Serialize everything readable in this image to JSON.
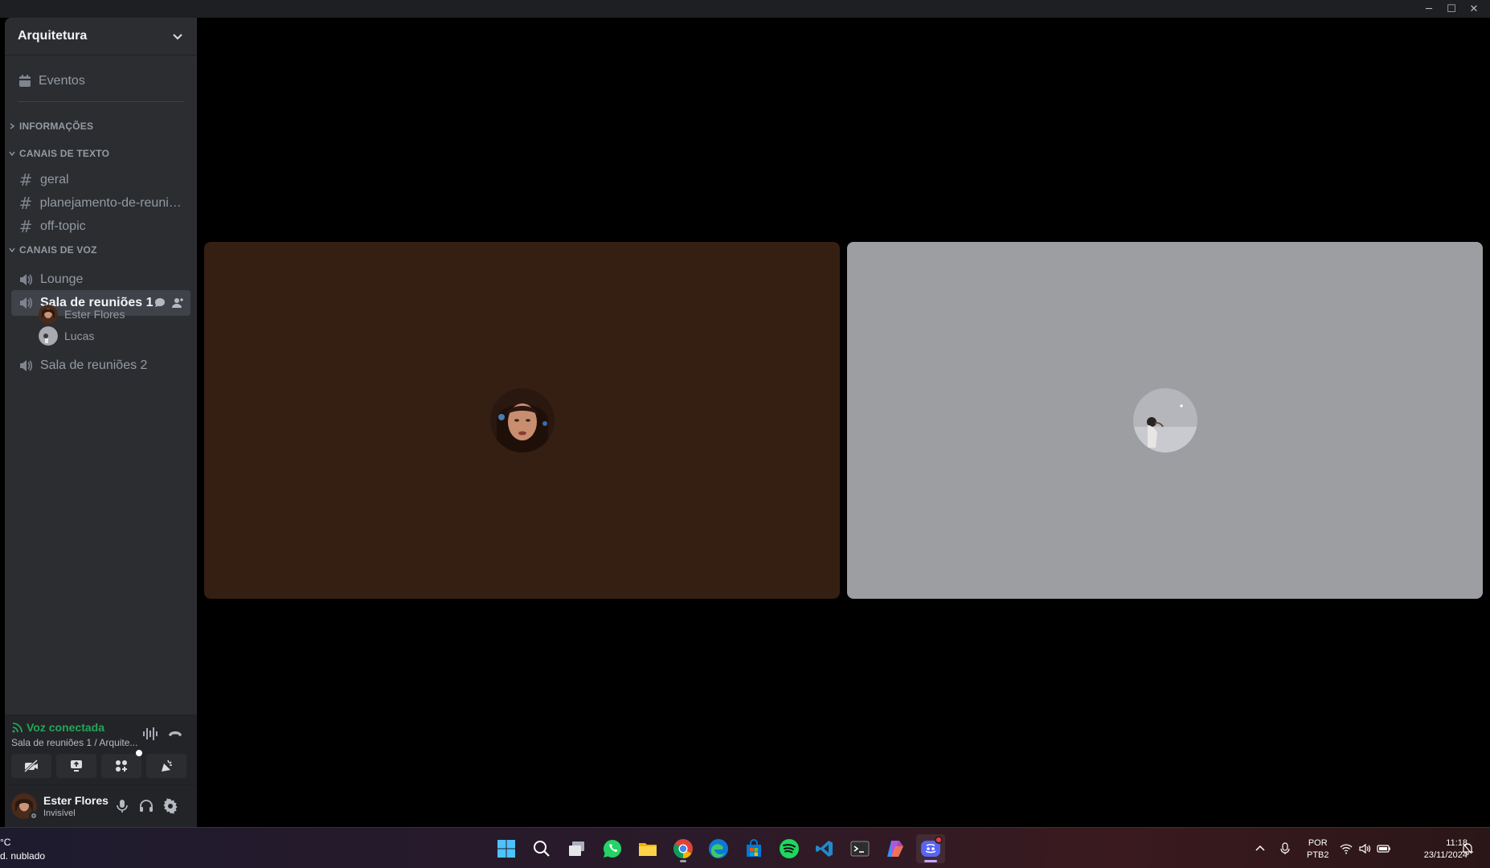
{
  "window": {
    "minimize": "─",
    "maximize": "☐",
    "close": "✕"
  },
  "server": {
    "name": "Arquitetura",
    "events_label": "Eventos"
  },
  "categories": {
    "info": "INFORMAÇÕES",
    "text": "CANAIS DE TEXTO",
    "voice": "CANAIS DE VOZ"
  },
  "text_channels": [
    {
      "name": "geral"
    },
    {
      "name": "planejamento-de-reuniõ..."
    },
    {
      "name": "off-topic"
    }
  ],
  "voice_channels": [
    {
      "name": "Lounge"
    },
    {
      "name": "Sala de reuniões 1"
    },
    {
      "name": "Sala de reuniões 2"
    }
  ],
  "voice_members": [
    {
      "name": "Ester Flores"
    },
    {
      "name": "Lucas"
    }
  ],
  "voice_panel": {
    "status": "Voz conectada",
    "location": "Sala de reuniões 1 / Arquite..."
  },
  "user": {
    "name": "Ester Flores",
    "status": "Invisível"
  },
  "taskbar": {
    "weather_temp": "°C",
    "weather_desc": "d. nublado",
    "lang_top": "POR",
    "lang_bottom": "PTB2",
    "time": "11:18",
    "date": "23/11/2024",
    "apps": [
      "start-icon",
      "search-icon",
      "task-view-icon",
      "whatsapp-icon",
      "file-explorer-icon",
      "chrome-icon",
      "edge-icon",
      "microsoft-store-icon",
      "spotify-icon",
      "vscode-icon",
      "terminal-icon",
      "copilot-icon",
      "discord-icon"
    ]
  },
  "colors": {
    "sidebar": "#2b2d31",
    "panel": "#232428",
    "active_channel": "#404249",
    "voice_green": "#23a55a",
    "tile_left": "#351f12",
    "tile_right": "#9d9ea2"
  }
}
